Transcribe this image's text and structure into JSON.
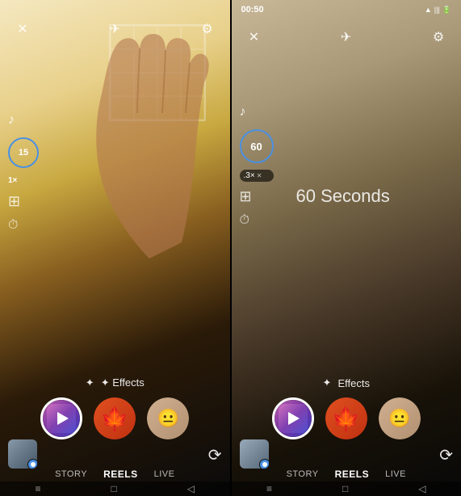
{
  "panels": {
    "left": {
      "timer": "15",
      "speed": "1×",
      "effects_label": "✦ Effects",
      "modes": [
        "STORY",
        "REELS",
        "LIVE"
      ],
      "active_mode": "REELS",
      "effects": [
        {
          "id": "reels",
          "active": true
        },
        {
          "id": "maple",
          "active": false
        },
        {
          "id": "face",
          "active": false
        }
      ]
    },
    "right": {
      "status_time": "00:50",
      "timer": "60",
      "speed": ".3×",
      "seconds_text": "60 Seconds",
      "effects_label": "✦ Effects",
      "modes": [
        "STORY",
        "REELS",
        "LIVE"
      ],
      "active_mode": "REELS",
      "effects": [
        {
          "id": "reels",
          "active": true
        },
        {
          "id": "maple",
          "active": false
        },
        {
          "id": "face",
          "active": false
        }
      ]
    }
  },
  "icons": {
    "close": "✕",
    "flash_off": "✈",
    "settings": "⚙",
    "music": "♪",
    "layout": "⊞",
    "timer_clock": "⏱",
    "effects_star": "✦",
    "flip_camera": "⟳",
    "nav_menu": "≡",
    "nav_home": "□",
    "nav_back": "◁"
  }
}
